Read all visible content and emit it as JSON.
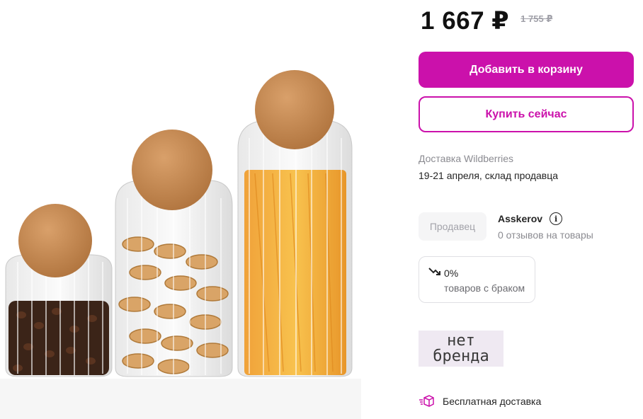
{
  "price": {
    "current": "1 667 ₽",
    "old": "1 755 ₽"
  },
  "buttons": {
    "add_to_cart": "Добавить в корзину",
    "buy_now": "Купить сейчас"
  },
  "delivery": {
    "title": "Доставка Wildberries",
    "date": "19-21 апреля, склад продавца"
  },
  "seller": {
    "badge": "Продавец",
    "name": "Asskerov",
    "reviews": "0 отзывов на товары"
  },
  "defects": {
    "value": "0%",
    "label": "товаров с браком"
  },
  "brand": {
    "line1": "нет",
    "line2": "бренда"
  },
  "free_delivery": "Бесплатная доставка",
  "colors": {
    "accent": "#cb11ab",
    "muted_text": "#8b8b91",
    "badge_bg": "#f5f5f6"
  },
  "icons": {
    "info": "info-icon",
    "trend": "trend-down-icon",
    "box": "box-delivery-icon"
  }
}
